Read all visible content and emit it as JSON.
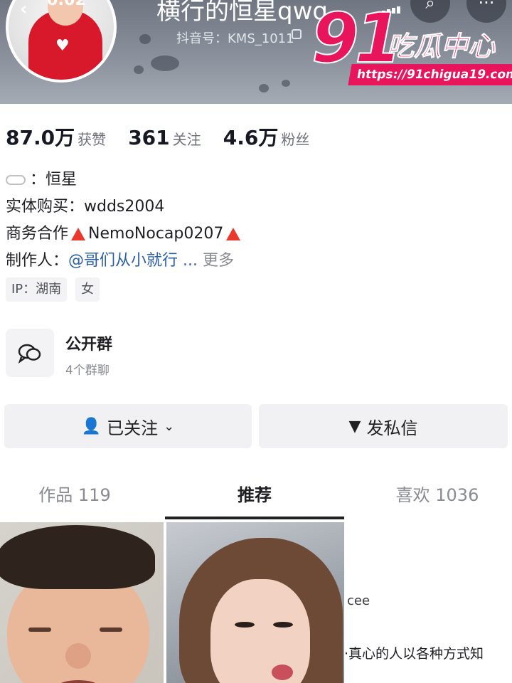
{
  "header": {
    "nickname": "横行的恒星qwq",
    "time_fragment": "0:02",
    "douyin_id": "抖音号：KMS_1011"
  },
  "watermark": {
    "number": "91",
    "text": "吃瓜中心",
    "url": "https://91chigua19.com"
  },
  "stats": [
    {
      "value": "87.0万",
      "label": "获赞"
    },
    {
      "value": "361",
      "label": "关注"
    },
    {
      "value": "4.6万",
      "label": "粉丝"
    }
  ],
  "bio": {
    "line1": "：恒星",
    "line2": "实体购买：wdds2004",
    "line3_prefix": "商务合作",
    "line3_value": "NemoNocap0207",
    "line4_prefix": "制作人：",
    "line4_mention": "@哥们从小就行 ...",
    "line4_more": "更多"
  },
  "tags": [
    "IP：湖南",
    "女"
  ],
  "group": {
    "title": "公开群",
    "subtitle": "4个群聊"
  },
  "buttons": {
    "follow": "已关注",
    "message": "发私信"
  },
  "tabs": {
    "works": "作品 119",
    "recommend": "推荐",
    "likes": "喜欢 1036"
  },
  "grid": {
    "cell3_text1": "cee",
    "cell3_text2": "·真心的人以各种方式知"
  },
  "colors": {
    "accent_pink": "#e8155d",
    "warning_red": "#e8392c",
    "mention_blue": "#2a5fa8"
  }
}
